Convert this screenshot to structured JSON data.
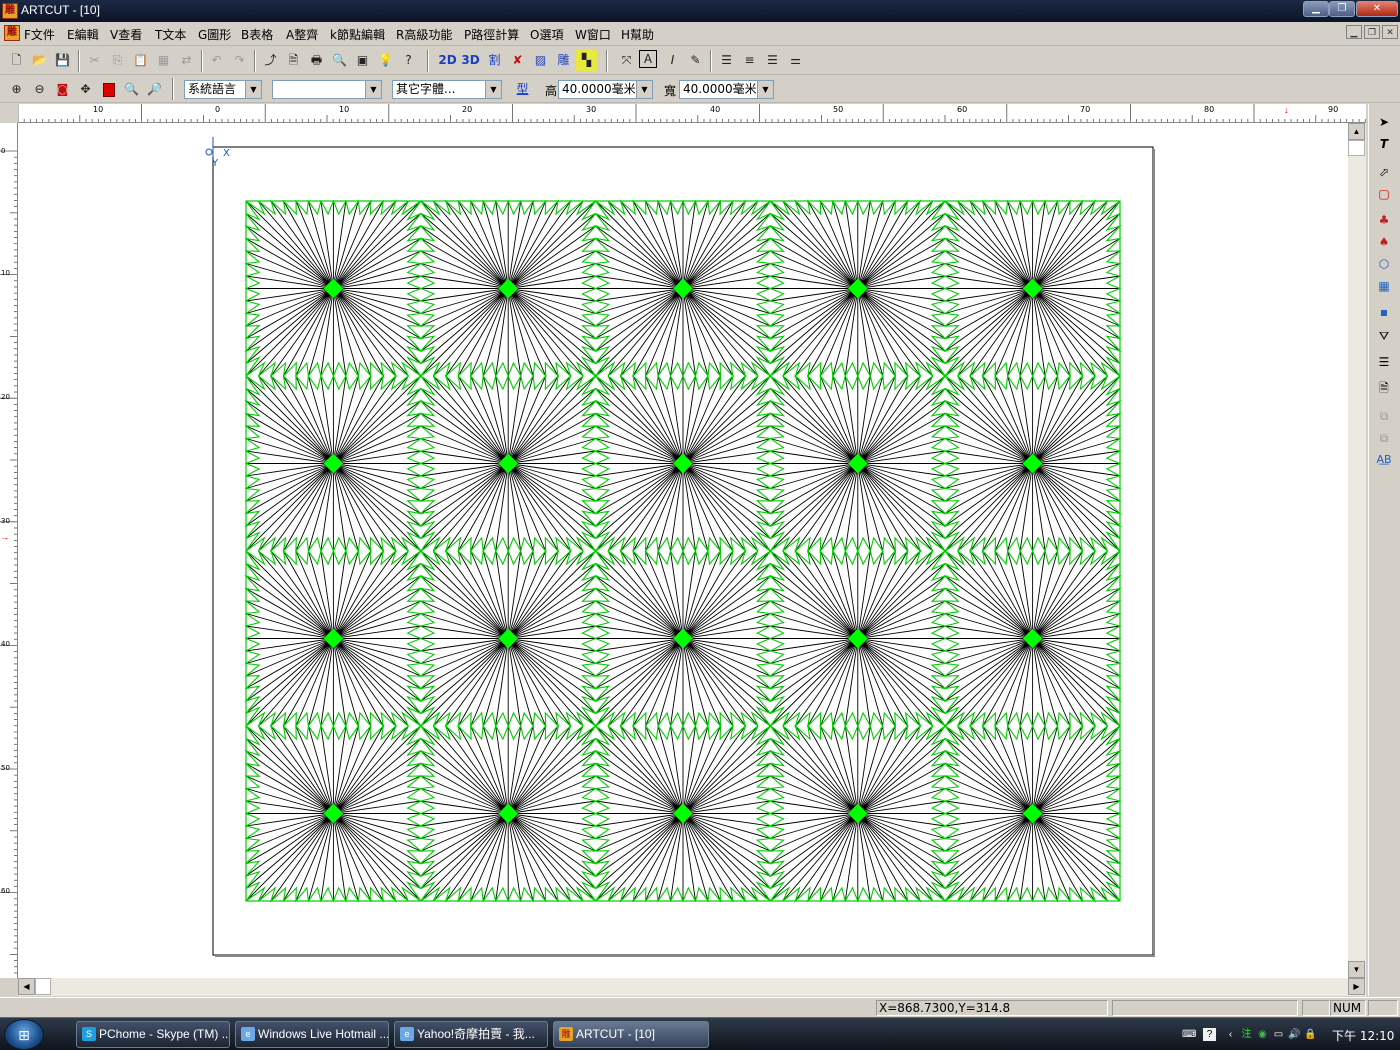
{
  "window": {
    "title": "ARTCUT - [10]"
  },
  "menu": [
    "F文件",
    "E編輯",
    "V查看",
    "T文本",
    "G圖形",
    "B表格",
    "A整齊",
    "k節點編輯",
    "R高級功能",
    "P路徑計算",
    "O選項",
    "W窗口",
    "H幫助"
  ],
  "toolbar1": {
    "btn_2d": "2D",
    "btn_3d": "3D",
    "btn_cut": "割",
    "btn_carve": "雕"
  },
  "toolbar2": {
    "language_select": "系統語言",
    "font_select": "",
    "other_font_select": "其它字體...",
    "type_button": "型",
    "height_label": "高",
    "height_value": "40.0000毫米",
    "width_label": "寬",
    "width_value": "40.0000毫米"
  },
  "ruler": {
    "h_labels": [
      "10",
      "0",
      "10",
      "20",
      "30",
      "40",
      "50",
      "60",
      "70",
      "80",
      "90"
    ],
    "v_labels": [
      "0",
      "10",
      "20",
      "30",
      "40",
      "50",
      "60"
    ]
  },
  "canvas": {
    "origin_label_x": "X",
    "origin_label_y": "Y",
    "pattern": {
      "rows": 4,
      "cols": 5,
      "line_color": "#000000",
      "outline_color": "#00cc00",
      "center_color": "#00ff00"
    }
  },
  "status": {
    "coords": "X=868.7300,Y=314.8",
    "num": "NUM"
  },
  "taskbar": {
    "tasks": [
      {
        "label": "PChome - Skype (TM) ...",
        "icon": "skype-icon"
      },
      {
        "label": "Windows Live Hotmail ...",
        "icon": "ie-icon"
      },
      {
        "label": "Yahoo!奇摩拍賣 - 我...",
        "icon": "ie-icon"
      },
      {
        "label": "ARTCUT - [10]",
        "icon": "artcut-icon"
      }
    ],
    "clock": "下午 12:10"
  }
}
